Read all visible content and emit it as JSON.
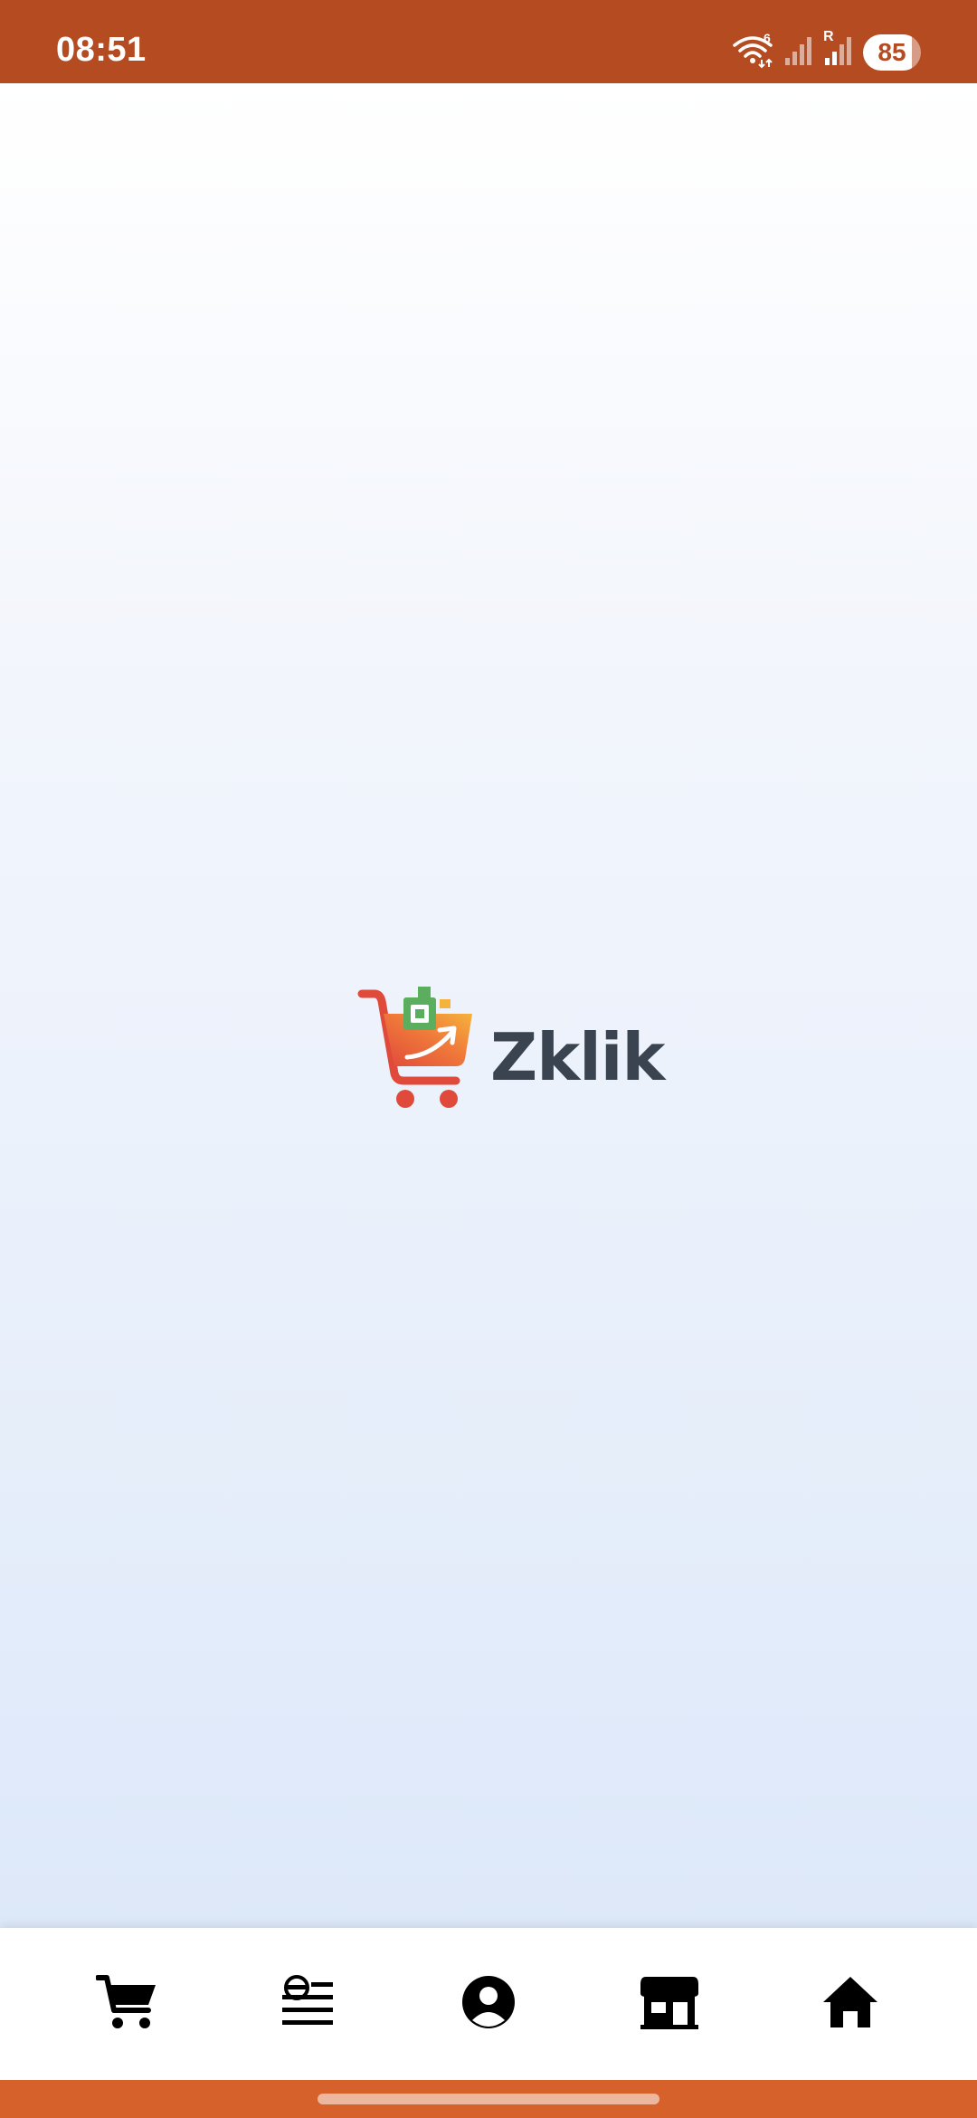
{
  "status_bar": {
    "time": "08:51",
    "battery_level": "85",
    "battery_fraction": 0.85,
    "icons": [
      "wifi-icon",
      "signal-icon",
      "signal-roaming-icon",
      "battery-icon"
    ],
    "roaming_label": "R",
    "wifi_label": "6"
  },
  "splash": {
    "app_name": "Zklik",
    "logo_icon": "shopping-cart-icon"
  },
  "bottom_nav": {
    "items": [
      {
        "icon": "cart-icon"
      },
      {
        "icon": "orders-list-icon"
      },
      {
        "icon": "account-icon"
      },
      {
        "icon": "store-icon"
      },
      {
        "icon": "home-icon"
      }
    ]
  },
  "colors": {
    "status_bar": "#b44b21",
    "gesture_bar": "#d7612a",
    "logo_text": "#3a4350",
    "cart_red": "#e04a3b",
    "cart_orange": "#f2a33a",
    "cart_green": "#5aae5e"
  }
}
